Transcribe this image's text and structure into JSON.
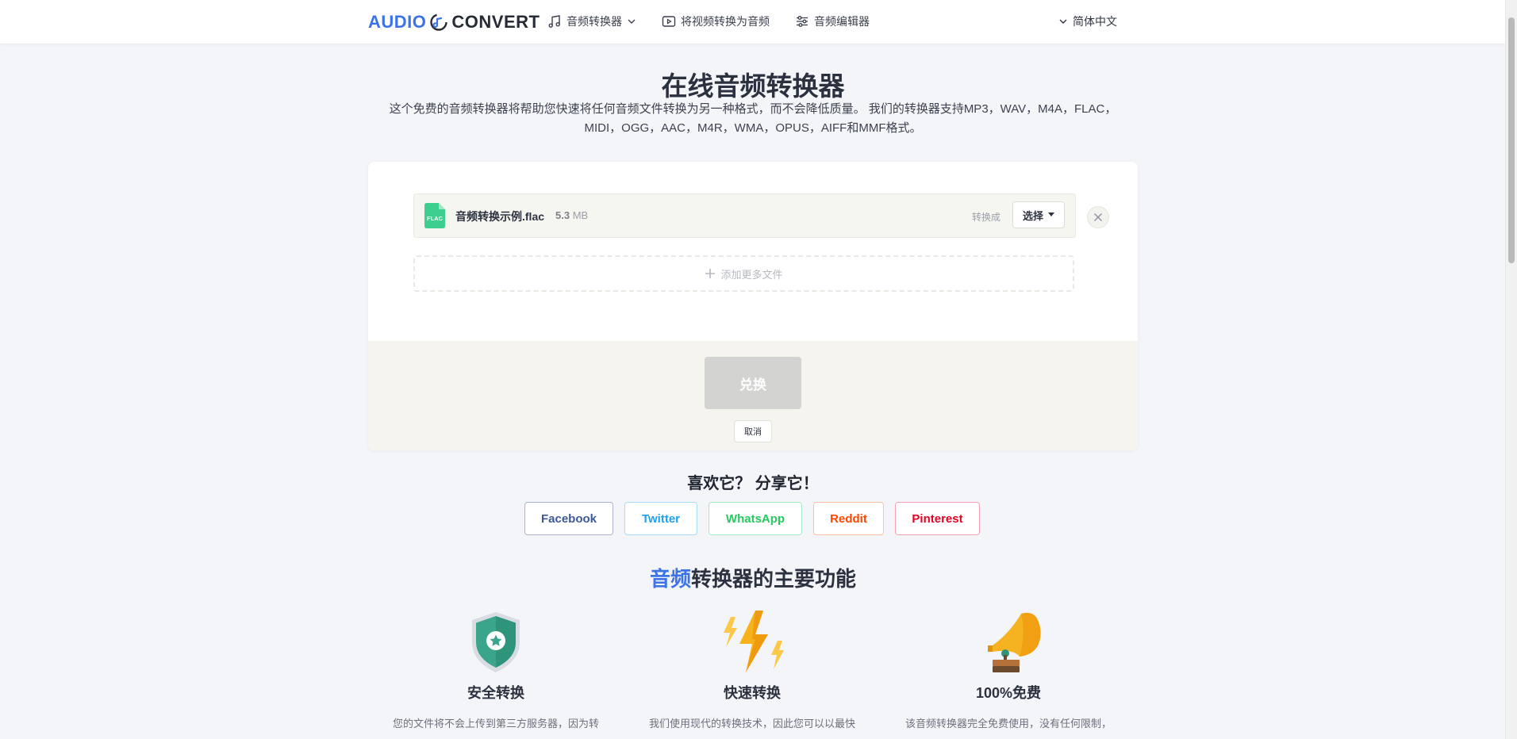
{
  "header": {
    "logo": {
      "part1": "AUDIO",
      "part2": "CONVERT"
    },
    "nav": [
      {
        "label": "音频转换器",
        "icon": "music-note-icon",
        "has_dropdown": true
      },
      {
        "label": "将视频转换为音频",
        "icon": "video-play-icon"
      },
      {
        "label": "音频编辑器",
        "icon": "sliders-icon"
      }
    ],
    "language": "简体中文"
  },
  "hero": {
    "title": "在线音频转换器",
    "description": "这个免费的音频转换器将帮助您快速将任何音频文件转换为另一种格式，而不会降低质量。 我们的转换器支持MP3，WAV，M4A，FLAC，MIDI，OGG，AAC，M4R，WMA，OPUS，AIFF和MMF格式。"
  },
  "converter": {
    "file": {
      "icon_label": "FLAC",
      "name": "音频转换示例.flac",
      "size_value": "5.3",
      "size_unit": "MB"
    },
    "convert_to_label": "转换成",
    "select_label": "选择",
    "add_more_label": "添加更多文件",
    "convert_button": "兑换",
    "cancel_button": "取消"
  },
  "share": {
    "title": "喜欢它？ 分享它！",
    "buttons": [
      {
        "label": "Facebook",
        "color": "#3b5998"
      },
      {
        "label": "Twitter",
        "color": "#1da1f2"
      },
      {
        "label": "WhatsApp",
        "color": "#25d366"
      },
      {
        "label": "Reddit",
        "color": "#ff4500"
      },
      {
        "label": "Pinterest",
        "color": "#e60023"
      }
    ]
  },
  "features": {
    "title_accent": "音频",
    "title_rest": "转换器的主要功能",
    "items": [
      {
        "icon": "shield-star-icon",
        "title": "安全转换",
        "desc": "您的文件将不会上传到第三方服务器，因为转"
      },
      {
        "icon": "lightning-icon",
        "title": "快速转换",
        "desc": "我们使用现代的转换技术，因此您可以以最快"
      },
      {
        "icon": "gramophone-icon",
        "title": "100%免费",
        "desc": "该音频转换器完全免费使用，没有任何限制，"
      }
    ]
  },
  "colors": {
    "accent": "#3d73e8",
    "background": "#f4f5f9",
    "flac_green": "#3ccf8e"
  }
}
